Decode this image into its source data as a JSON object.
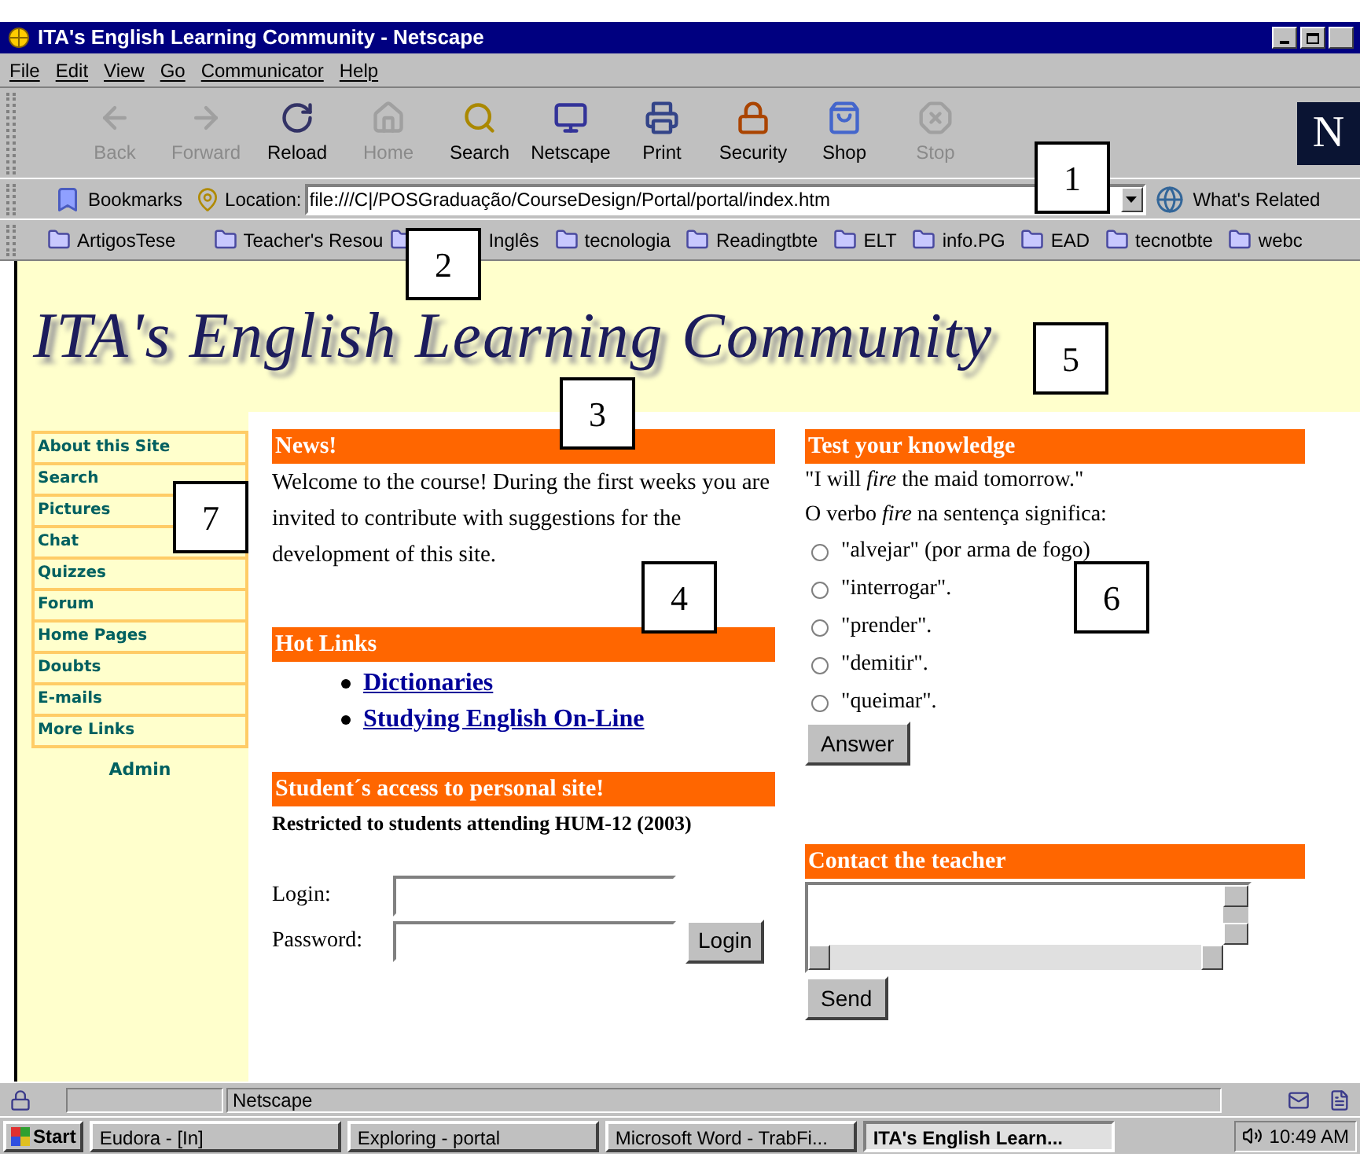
{
  "window": {
    "title": "ITA's English Learning Community - Netscape"
  },
  "menu": [
    "File",
    "Edit",
    "View",
    "Go",
    "Communicator",
    "Help"
  ],
  "toolbar": [
    {
      "label": "Back",
      "disabled": true
    },
    {
      "label": "Forward",
      "disabled": true
    },
    {
      "label": "Reload",
      "disabled": false
    },
    {
      "label": "Home",
      "disabled": true
    },
    {
      "label": "Search",
      "disabled": false
    },
    {
      "label": "Netscape",
      "disabled": false
    },
    {
      "label": "Print",
      "disabled": false
    },
    {
      "label": "Security",
      "disabled": false
    },
    {
      "label": "Shop",
      "disabled": false
    },
    {
      "label": "Stop",
      "disabled": true
    }
  ],
  "throbber": {
    "letter": "N"
  },
  "location_bar": {
    "bookmarks": "Bookmarks",
    "location_label": "Location:",
    "url": "file:///C|/POSGraduação/CourseDesign/Portal/portal/index.htm",
    "whats_related": "What's Related"
  },
  "personal_toolbar": [
    "ArtigosTese",
    "Teacher's Resou",
    "Inglês",
    "tecnologia",
    "Readingtbte",
    "ELT",
    "info.PG",
    "EAD",
    "tecnotbte",
    "webc"
  ],
  "page": {
    "logo": "ITA's English Learning Community",
    "sidebar": [
      "About this Site",
      "Search",
      "Pictures",
      "Chat",
      "Quizzes",
      "Forum",
      "Home Pages",
      "Doubts",
      "E-mails",
      "More Links"
    ],
    "admin": "Admin",
    "news": {
      "title": "News!",
      "text": "Welcome to the course! During the first weeks you are invited to contribute with suggestions for the development of this site."
    },
    "hot_links": {
      "title": "Hot Links",
      "links": [
        "Dictionaries",
        "Studying English On-Line"
      ]
    },
    "student_access": {
      "title": "Student´s access to personal site!",
      "note": "Restricted to students attending HUM-12 (2003)",
      "login_label": "Login:",
      "password_label": "Password:",
      "button": "Login"
    },
    "quiz": {
      "title": "Test your knowledge",
      "sentence": "\"I will *fire* the maid tomorrow.\"",
      "question": "O verbo *fire* na sentença significa:",
      "options": [
        {
          "label": "\"alvejar\" (por arma de fogo)",
          "selected": false
        },
        {
          "label": "\"interrogar\".",
          "selected": false
        },
        {
          "label": "\"prender\".",
          "selected": false
        },
        {
          "label": "\"demitir\".",
          "selected": false
        },
        {
          "label": "\"queimar\".",
          "selected": false
        }
      ],
      "button": "Answer"
    },
    "contact": {
      "title": "Contact the teacher",
      "button": "Send"
    }
  },
  "status_bar": {
    "text": "Netscape"
  },
  "taskbar": {
    "start": "Start",
    "tasks": [
      {
        "label": "Eudora - [In]",
        "selected": false
      },
      {
        "label": "Exploring - portal",
        "selected": false
      },
      {
        "label": "Microsoft Word - TrabFi...",
        "selected": false
      },
      {
        "label": "ITA's English Learn...",
        "selected": true
      }
    ],
    "time": "10:49 AM"
  },
  "callouts": [
    "1",
    "2",
    "3",
    "4",
    "5",
    "6",
    "7"
  ]
}
